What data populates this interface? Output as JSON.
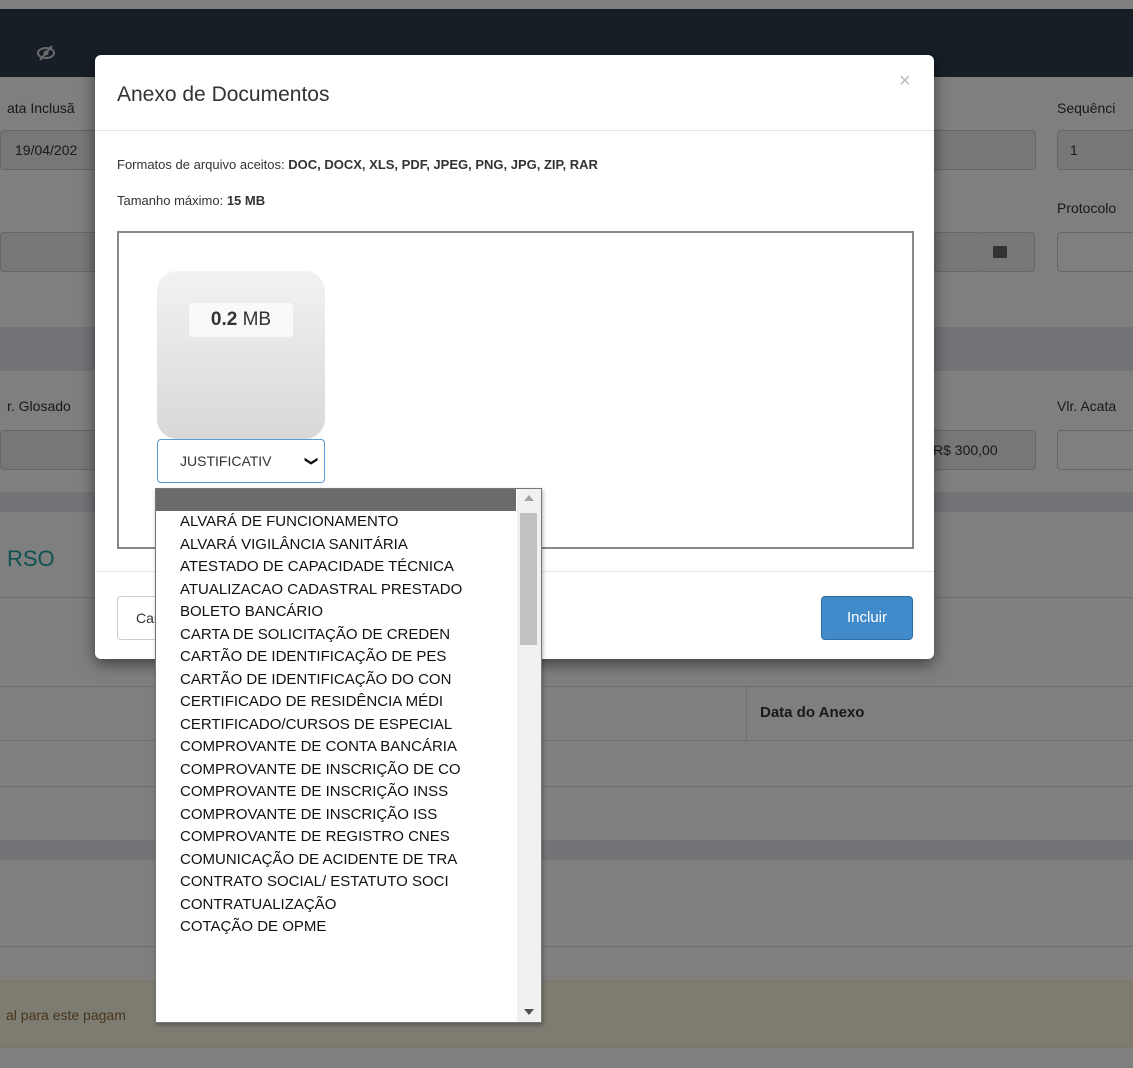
{
  "background": {
    "labels": {
      "data_inclusao": "ata Inclusã",
      "sequencia": "Sequênci",
      "protocolo": "Protocolo",
      "vlr_glosado": "r. Glosado",
      "vlr_acatado": "Vlr. Acata"
    },
    "values": {
      "data_inclusao": "19/04/202",
      "sequencia": "1",
      "valor": "R$ 300,00"
    },
    "section_title": "RSO",
    "table_header_data_anexo": "Data do Anexo",
    "alert_text": "al para este pagam"
  },
  "modal": {
    "title": "Anexo de Documentos",
    "close_icon": "×",
    "formats_label": "Formatos de arquivo aceitos: ",
    "formats_value": "DOC, DOCX, XLS, PDF, JPEG, PNG, JPG, ZIP, RAR",
    "max_size_label": "Tamanho máximo: ",
    "max_size_value": "15 MB",
    "file_size_number": "0.2",
    "file_size_unit": " MB",
    "doc_type_selected": "JUSTIFICATIV",
    "cancel_label": "Cancelar",
    "include_label": "Incluir",
    "include_color": "#428bca"
  },
  "dropdown": {
    "options": [
      "",
      "ALVARÁ DE FUNCIONAMENTO",
      "ALVARÁ VIGILÂNCIA SANITÁRIA",
      "ATESTADO DE CAPACIDADE TÉCNICA",
      "ATUALIZACAO CADASTRAL PRESTADO",
      "BOLETO BANCÁRIO",
      "CARTA DE SOLICITAÇÃO DE CREDEN",
      "CARTÃO DE IDENTIFICAÇÃO DE PES",
      "CARTÃO DE IDENTIFICAÇÃO DO CON",
      "CERTIFICADO DE RESIDÊNCIA MÉDI",
      "CERTIFICADO/CURSOS DE ESPECIAL",
      "COMPROVANTE DE CONTA BANCÁRIA",
      "COMPROVANTE DE INSCRIÇÃO DE CO",
      "COMPROVANTE DE INSCRIÇÃO INSS",
      "COMPROVANTE DE INSCRIÇÃO ISS",
      "COMPROVANTE DE REGISTRO CNES",
      "COMUNICAÇÃO DE ACIDENTE DE TRA",
      "CONTRATO SOCIAL/ ESTATUTO SOCI",
      "CONTRATUALIZAÇÃO",
      "COTAÇÃO DE OPME"
    ],
    "highlighted_index": 0
  }
}
